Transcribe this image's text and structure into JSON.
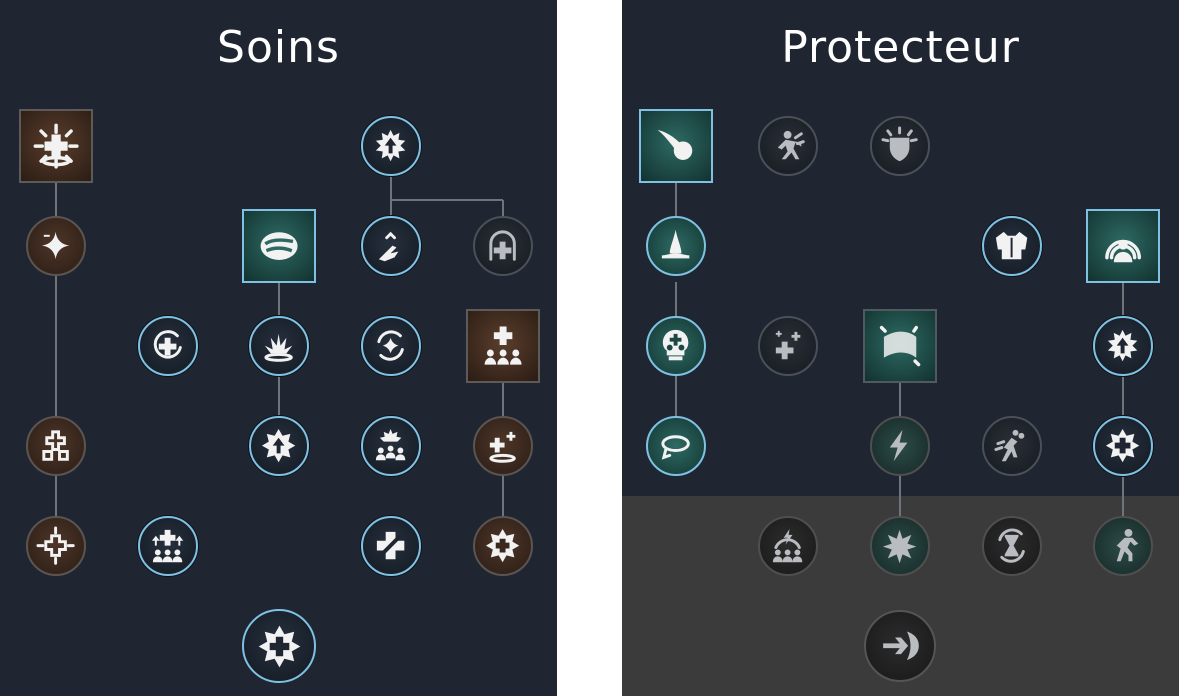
{
  "trees": [
    {
      "title": "Soins",
      "nodes": [
        {
          "icon": "burst-cross-icon",
          "state": "available"
        },
        {
          "icon": "burst-arrow-up-icon",
          "state": "learned"
        },
        {
          "icon": "star-minus-icon",
          "state": "available"
        },
        {
          "icon": "stone-icon",
          "state": "learned"
        },
        {
          "icon": "chevron-dash-icon",
          "state": "learned"
        },
        {
          "icon": "arch-cross-icon",
          "state": "unavailable"
        },
        {
          "icon": "circle-cross-icon",
          "state": "learned"
        },
        {
          "icon": "impact-burst-icon",
          "state": "learned"
        },
        {
          "icon": "cycle-star-icon",
          "state": "learned"
        },
        {
          "icon": "group-heal-icon",
          "state": "available"
        },
        {
          "icon": "split-cross-icon",
          "state": "available"
        },
        {
          "icon": "star-arrow-up-icon",
          "state": "learned"
        },
        {
          "icon": "group-burst-icon",
          "state": "learned"
        },
        {
          "icon": "cross-sparkle-icon",
          "state": "available"
        },
        {
          "icon": "radiant-cross-icon",
          "state": "available"
        },
        {
          "icon": "group-arrows-icon",
          "state": "learned"
        },
        {
          "icon": "slashed-cross-icon",
          "state": "learned"
        },
        {
          "icon": "star-cross-icon",
          "state": "available"
        },
        {
          "icon": "big-star-cross-icon",
          "state": "learned"
        }
      ]
    },
    {
      "title": "Protecteur",
      "nodes": [
        {
          "icon": "comet-icon",
          "state": "learned"
        },
        {
          "icon": "charge-icon",
          "state": "unavailable"
        },
        {
          "icon": "radiant-shield-icon",
          "state": "unavailable"
        },
        {
          "icon": "fountain-icon",
          "state": "learned"
        },
        {
          "icon": "armor-icon",
          "state": "learned"
        },
        {
          "icon": "aura-person-icon",
          "state": "learned"
        },
        {
          "icon": "skull-cross-icon",
          "state": "learned"
        },
        {
          "icon": "plus-cluster-icon",
          "state": "unavailable"
        },
        {
          "icon": "shield-slab-icon",
          "state": "available"
        },
        {
          "icon": "burst-arrow-up-icon",
          "state": "learned"
        },
        {
          "icon": "ring-icon",
          "state": "learned"
        },
        {
          "icon": "lightning-icon",
          "state": "unavailable"
        },
        {
          "icon": "sprint-icon",
          "state": "unavailable"
        },
        {
          "icon": "star-cross-icon",
          "state": "learned"
        },
        {
          "icon": "group-lightning-icon",
          "state": "locked"
        },
        {
          "icon": "explosion-icon",
          "state": "locked"
        },
        {
          "icon": "hourglass-icon",
          "state": "locked"
        },
        {
          "icon": "runner-icon",
          "state": "locked"
        },
        {
          "icon": "arrow-shield-icon",
          "state": "locked"
        }
      ]
    }
  ],
  "colors": {
    "panel": "#1f2632",
    "locked_zone": "#3b3b3b",
    "learned_border": "#7fc1e3",
    "teal": "#2e6a63",
    "brown": "#4e3628"
  }
}
